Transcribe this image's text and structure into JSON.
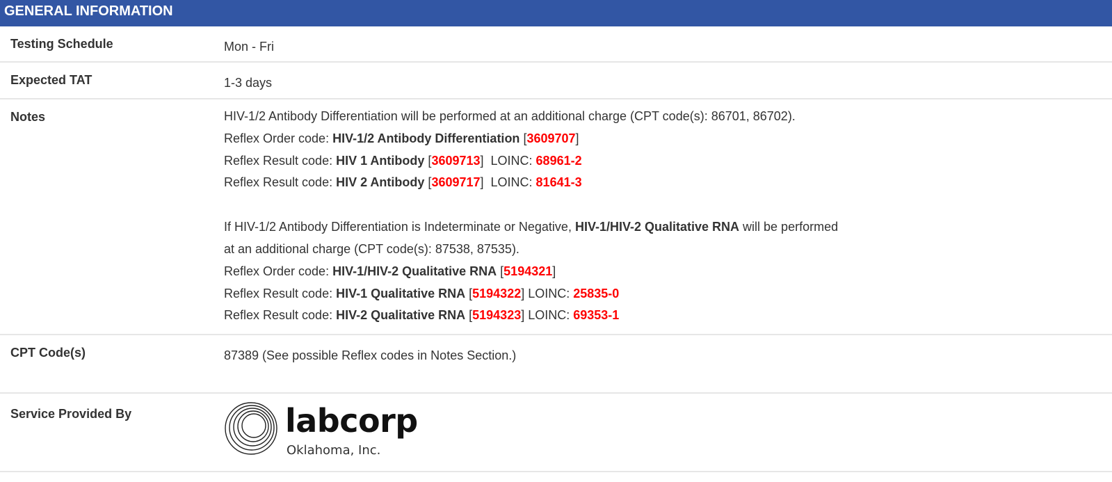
{
  "header": {
    "title": "GENERAL INFORMATION"
  },
  "schedule": {
    "label": "Testing Schedule",
    "value": "Mon - Fri"
  },
  "tat": {
    "label": "Expected TAT",
    "value": "1-3 days"
  },
  "notes": {
    "label": "Notes",
    "p1": "HIV-1/2 Antibody Differentiation will be performed at an additional charge (CPT code(s): 86701, 86702).",
    "order1": {
      "prefix": "Reflex Order code: ",
      "name": "HIV-1/2 Antibody Differentiation",
      "code": "3609707"
    },
    "result1": {
      "prefix": "Reflex Result code: ",
      "name": "HIV 1 Antibody",
      "code": "3609713",
      "loinc_label": "  LOINC: ",
      "loinc": "68961-2"
    },
    "result2": {
      "prefix": "Reflex Result code: ",
      "name": "HIV 2 Antibody",
      "code": "3609717",
      "loinc_label": "  LOINC: ",
      "loinc": "81641-3"
    },
    "p2_a": "If HIV-1/2 Antibody Differentiation is Indeterminate or Negative, ",
    "p2_b": "HIV-1/HIV-2 Qualitative RNA",
    "p2_c": " will be performed",
    "p2_d": "at an additional charge (CPT code(s): 87538, 87535).",
    "order2": {
      "prefix": "Reflex Order code: ",
      "name": "HIV-1/HIV-2 Qualitative RNA",
      "code": "5194321"
    },
    "result3": {
      "prefix": "Reflex Result code: ",
      "name": "HIV-1 Qualitative RNA",
      "code": "5194322",
      "loinc_label": " LOINC: ",
      "loinc": "25835-0"
    },
    "result4": {
      "prefix": "Reflex Result code: ",
      "name": "HIV-2 Qualitative RNA",
      "code": "5194323",
      "loinc_label": " LOINC: ",
      "loinc": "69353-1"
    }
  },
  "cpt": {
    "label": "CPT Code(s)",
    "value": "87389 (See possible Reflex codes in Notes Section.)"
  },
  "service": {
    "label": "Service Provided By",
    "logo_word": "labcorp",
    "logo_sub": "Oklahoma, Inc."
  },
  "colors": {
    "header_bg": "#3256a4",
    "code_red": "#ff0000",
    "text": "#333333"
  }
}
